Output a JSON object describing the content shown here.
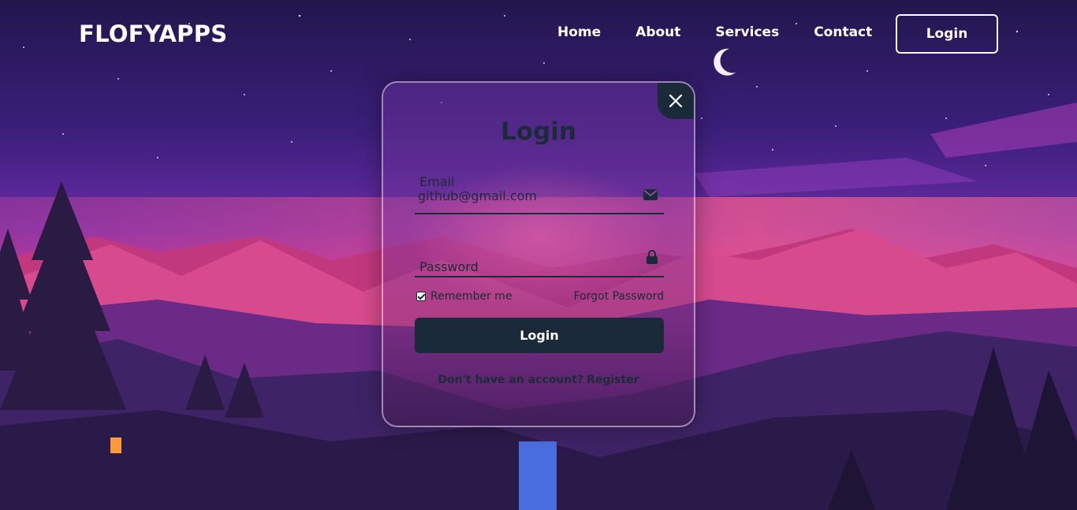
{
  "header": {
    "logo": "FLOFYAPPS",
    "nav": [
      "Home",
      "About",
      "Services",
      "Contact"
    ],
    "login_button": "Login"
  },
  "modal": {
    "title": "Login",
    "close_icon": "close-icon",
    "email": {
      "label": "Email",
      "value": "github@gmail.com",
      "icon": "mail-icon"
    },
    "password": {
      "label": "Password",
      "value": "",
      "icon": "lock-icon"
    },
    "remember_label": "Remember me",
    "remember_checked": true,
    "forgot_label": "Forgot Password",
    "submit_label": "Login",
    "register_prompt": "Don't have an account?",
    "register_link": "Register"
  },
  "colors": {
    "accent_dark": "#1a2a38",
    "sky_top": "#22164d",
    "sky_glow": "#ff4fa0",
    "text_light": "#ffffff"
  }
}
